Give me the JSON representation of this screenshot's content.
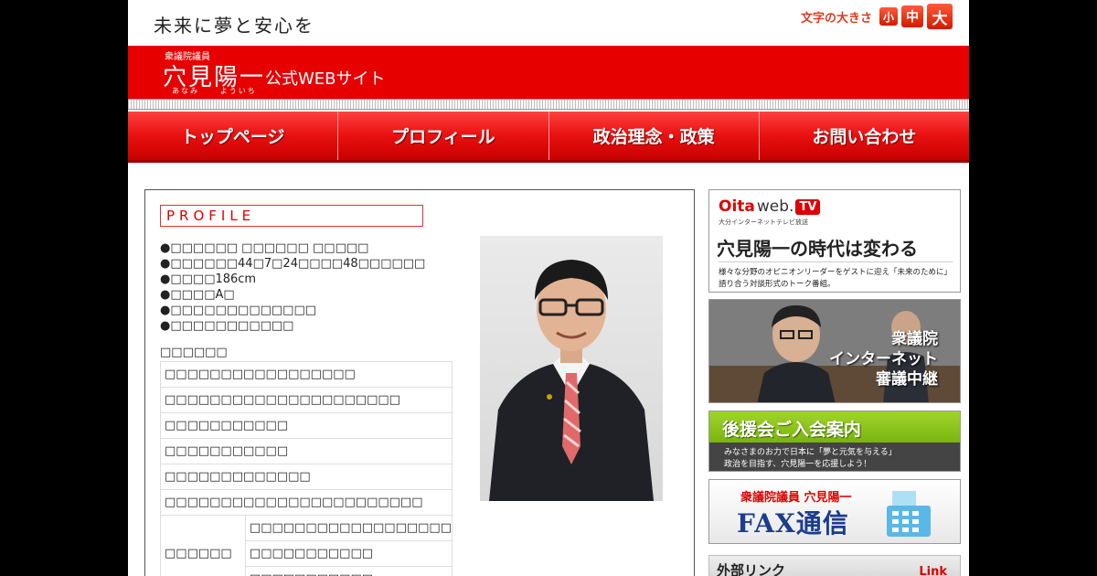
{
  "header": {
    "tagline": "未来に夢と安心を",
    "font_size_label": "文字の大きさ",
    "font_size_options": [
      "小",
      "中",
      "大"
    ]
  },
  "banner": {
    "role": "衆議院議員",
    "name": "穴見陽一",
    "ruby_first": "あなみ",
    "ruby_second": "よういち",
    "site": "公式WEBサイト"
  },
  "nav": {
    "items": [
      "トップページ",
      "プロフィール",
      "政治理念・政策",
      "お問い合わせ"
    ]
  },
  "profile": {
    "heading": "PROFILE",
    "bullets": [
      "●□□□□□□ □□□□□□ □□□□□",
      "●□□□□□□44□7□24□□□□48□□□□□□",
      "●□□□□186cm",
      "●□□□□A□",
      "●□□□□□□□□□□□□□",
      "●□□□□□□□□□□□"
    ],
    "career_heading": "□□□□□□",
    "career_rows": [
      "□□□□□□□□□□□□□□□□□",
      "□□□□□□□□□□□□□□□□□□□□□",
      "□□□□□□□□□□□",
      "□□□□□□□□□□□",
      "□□□□□□□□□□□□□",
      "□□□□□□□□□□□□□□□□□□□□□□□"
    ],
    "career_group_label": "□□□□□□",
    "career_group_rows": [
      "□□□□□□□□□□□□□□□□□□",
      "□□□□□□□□□□□",
      "□□□□□□□□□□□"
    ]
  },
  "sidebar": {
    "oita": {
      "logo_left": "Oita",
      "logo_mid": "web.",
      "logo_tv": "TV",
      "logo_sub": "大分インターネットテレビ放送",
      "title": "穴見陽一の時代は変わる",
      "desc1": "様々な分野のオピニオンリーダーをゲストに迎え「未来のために」",
      "desc2": "語り合う対談形式のトーク番組。"
    },
    "diet": {
      "line1": "衆議院",
      "line2": "インターネット",
      "line3": "審議中継"
    },
    "koenkai": {
      "title": "後援会ご入会案内",
      "desc1": "みなさまのお力で日本に「夢と元気を与える」",
      "desc2": "政治を目指す、穴見陽一を応援しよう！"
    },
    "fax": {
      "role": "衆議院議員 穴見陽一",
      "title": "FAX通信"
    },
    "links": {
      "heading": "外部リンク",
      "tag": "Link"
    }
  },
  "colors": {
    "brand_red": "#e60000",
    "nav_red": "#e81010",
    "koenkai_green": "#8bc21e"
  }
}
